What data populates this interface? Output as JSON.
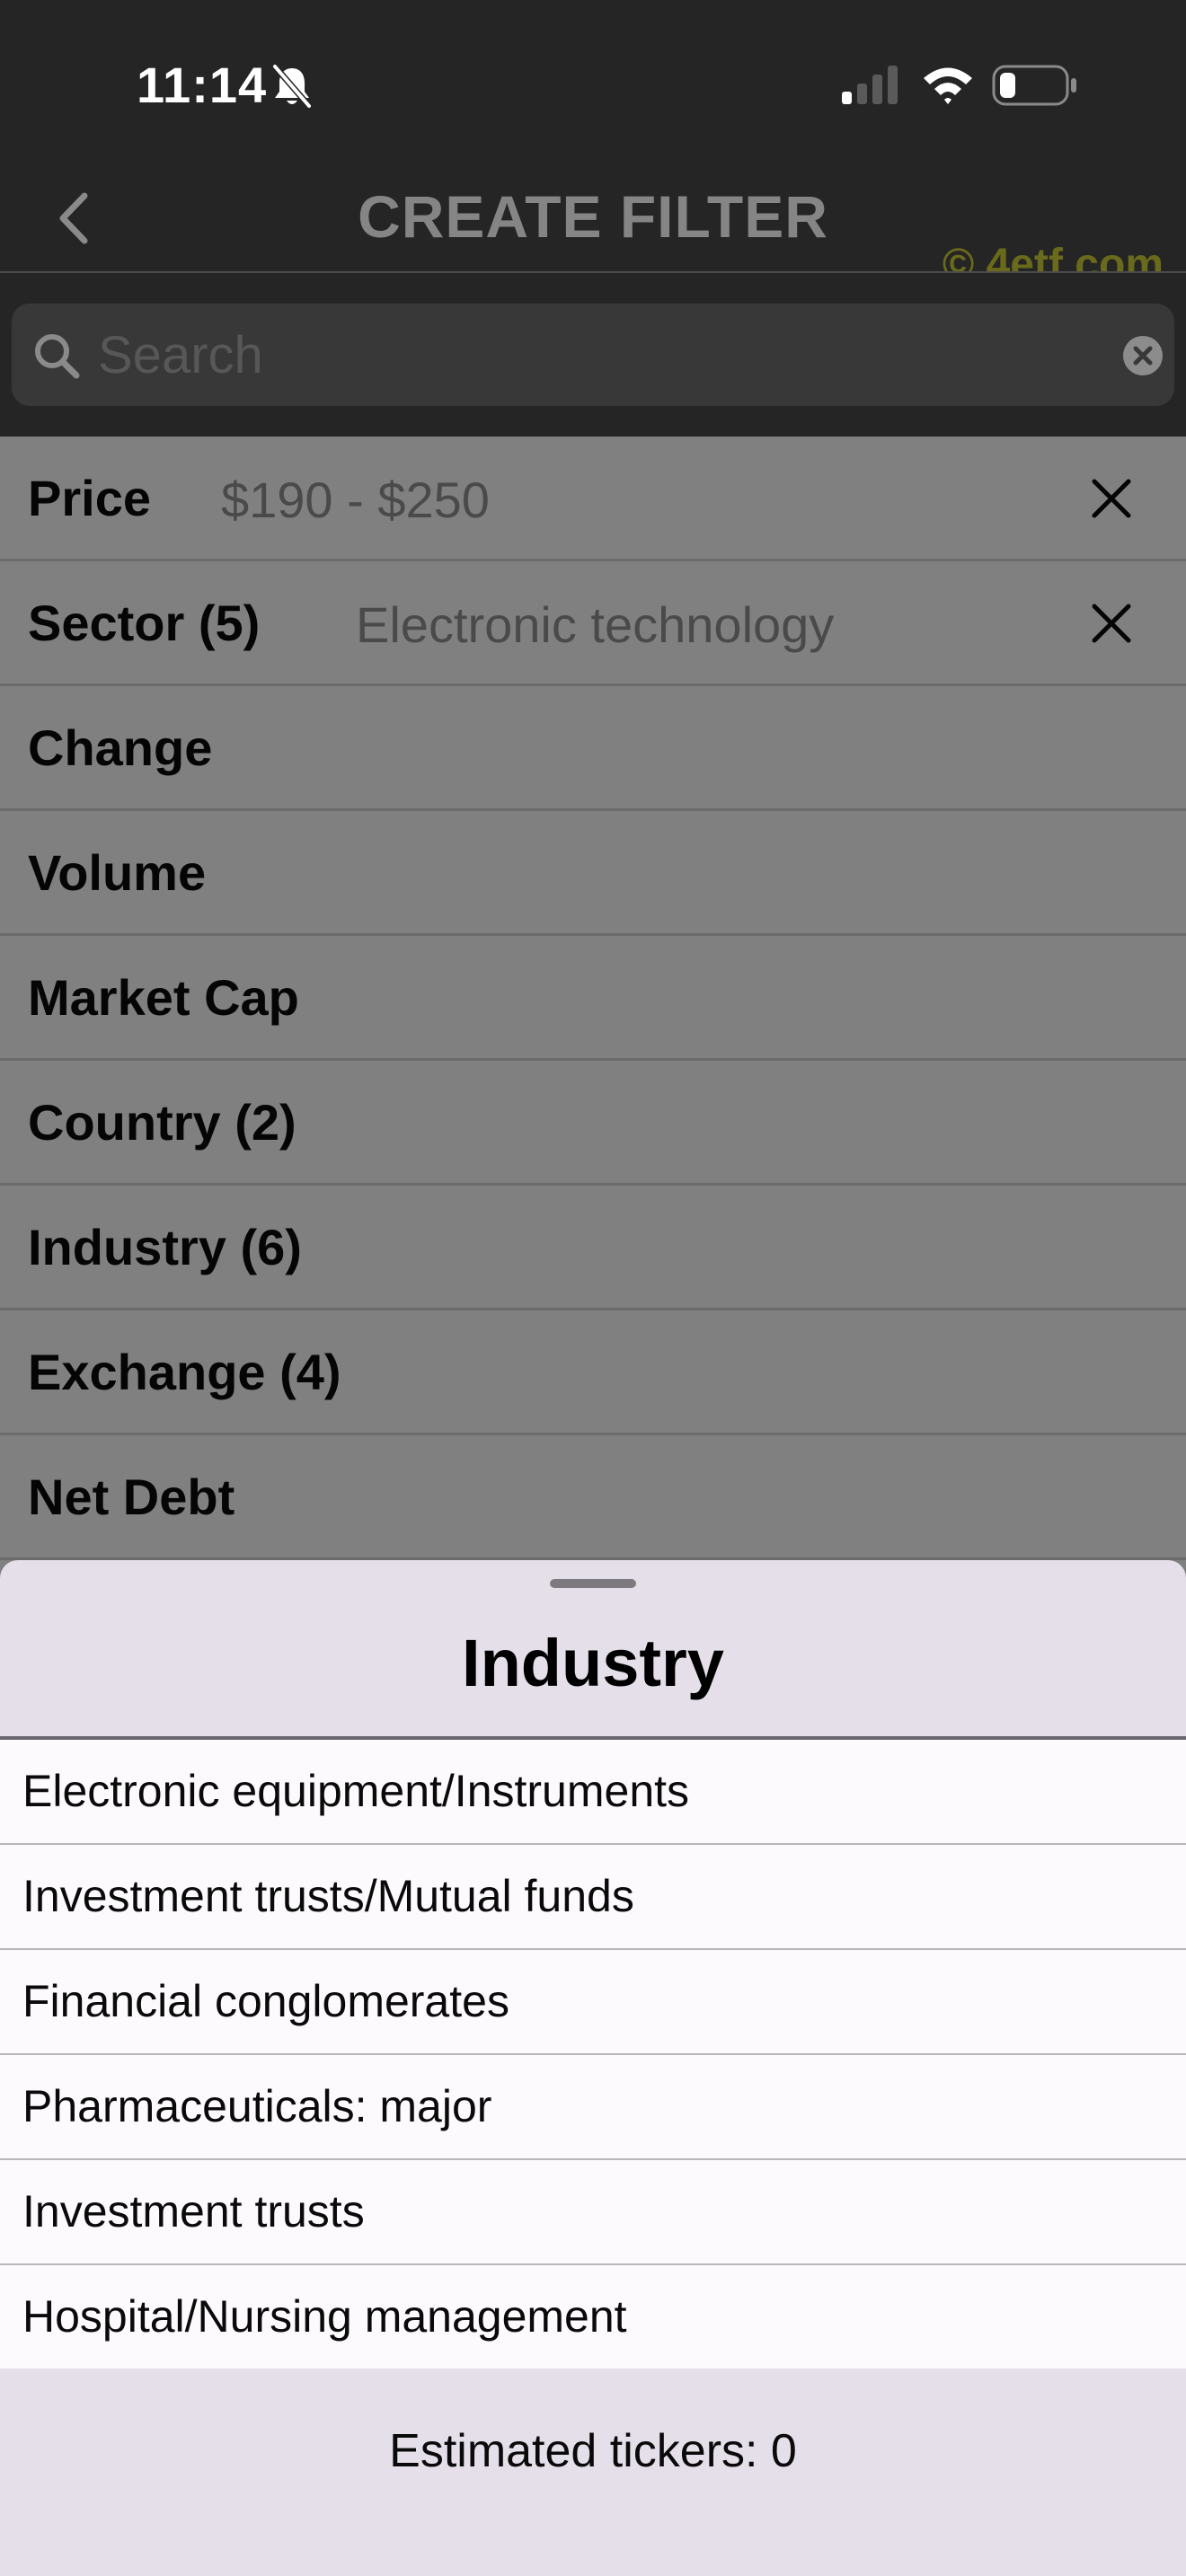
{
  "status_bar": {
    "time": "11:14",
    "icons": [
      "bell-slash-icon",
      "cellular-signal-icon",
      "wifi-icon",
      "battery-low-icon"
    ]
  },
  "nav": {
    "back_icon": "chevron-left-icon",
    "title": "CREATE FILTER",
    "watermark": "© 4etf.com"
  },
  "search": {
    "placeholder": "Search",
    "value": "",
    "icon": "search-icon",
    "clear_icon": "clear-circle-icon"
  },
  "filters": [
    {
      "label": "Price",
      "value": "$190 - $250",
      "removable": true
    },
    {
      "label": "Sector (5)",
      "value": "Electronic technology",
      "removable": true
    },
    {
      "label": "Change",
      "value": "",
      "removable": false
    },
    {
      "label": "Volume",
      "value": "",
      "removable": false
    },
    {
      "label": "Market Cap",
      "value": "",
      "removable": false
    },
    {
      "label": "Country (2)",
      "value": "",
      "removable": false
    },
    {
      "label": "Industry (6)",
      "value": "",
      "removable": false
    },
    {
      "label": "Exchange (4)",
      "value": "",
      "removable": false
    },
    {
      "label": "Net Debt",
      "value": "",
      "removable": false
    }
  ],
  "sheet": {
    "title": "Industry",
    "options": [
      "Electronic equipment/Instruments",
      "Investment trusts/Mutual funds",
      "Financial conglomerates",
      "Pharmaceuticals: major",
      "Investment trusts",
      "Hospital/Nursing management"
    ],
    "footer": "Estimated tickers: 0"
  },
  "colors": {
    "header_bg": "#252525",
    "dimmed_list_bg": "#808080",
    "sheet_bg": "#e5dfea",
    "option_bg": "#fdfafd",
    "watermark": "#6a6a1c"
  }
}
